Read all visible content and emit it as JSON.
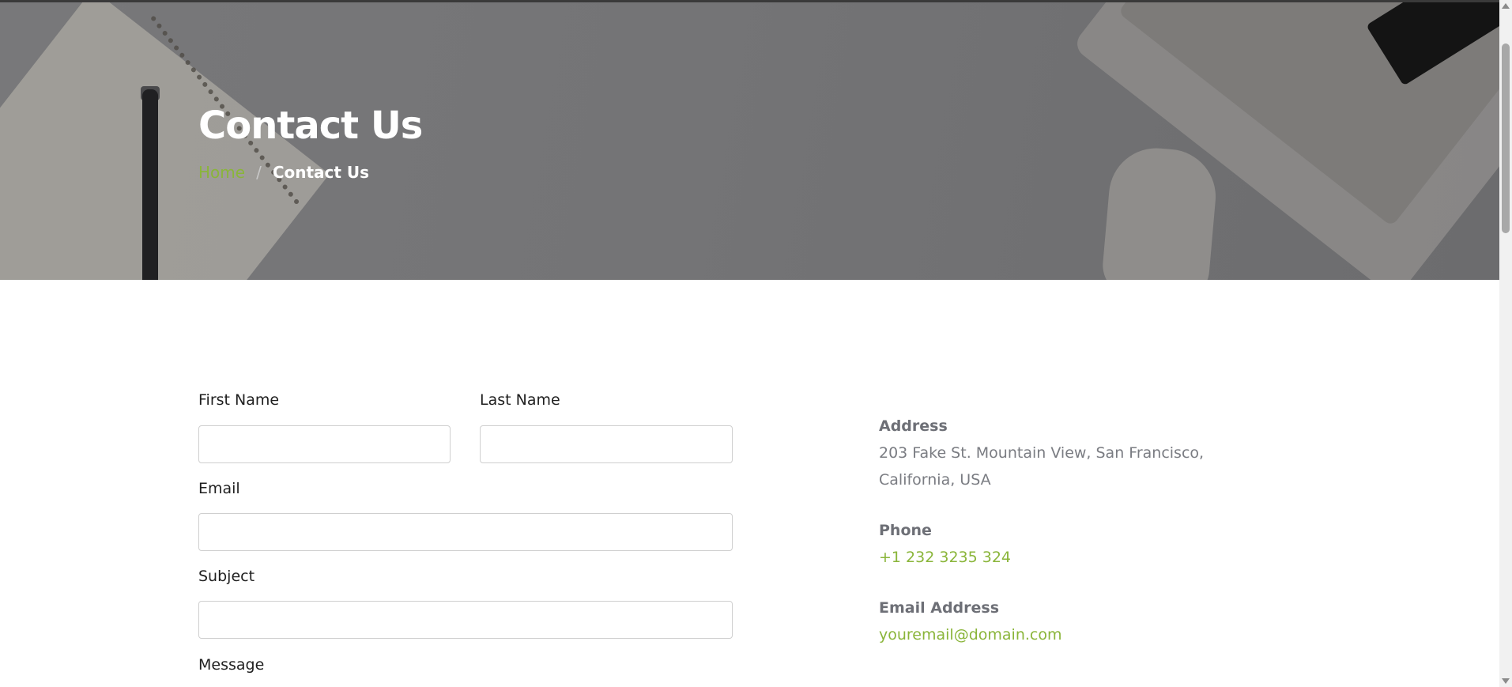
{
  "hero": {
    "title": "Contact Us",
    "breadcrumb": {
      "home": "Home",
      "separator": "/",
      "current": "Contact Us"
    }
  },
  "form": {
    "first_name_label": "First Name",
    "last_name_label": "Last Name",
    "email_label": "Email",
    "subject_label": "Subject",
    "message_label": "Message",
    "first_name_value": "",
    "last_name_value": "",
    "email_value": "",
    "subject_value": ""
  },
  "contact_info": {
    "address_heading": "Address",
    "address_text": "203 Fake St. Mountain View, San Francisco, California, USA",
    "phone_heading": "Phone",
    "phone_value": "+1 232 3235 324",
    "email_heading": "Email Address",
    "email_value": "youremail@domain.com"
  },
  "colors": {
    "accent": "#8ab53a",
    "hero_overlay": "#747476",
    "muted_text": "#7a7c82"
  }
}
